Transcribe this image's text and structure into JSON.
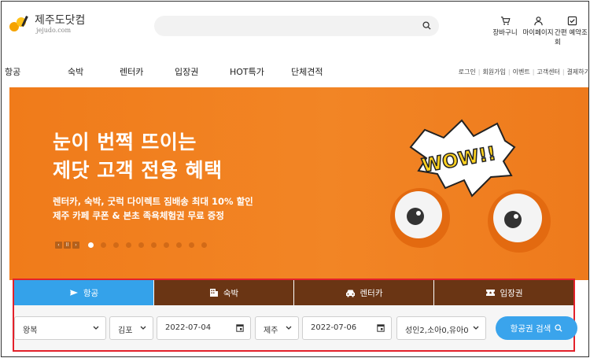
{
  "logo": {
    "name": "제주도닷컴",
    "sub": "jejudo.com"
  },
  "search": {
    "placeholder": ""
  },
  "utility": {
    "cart": "장바구니",
    "mypage": "마이페이지",
    "quick": "간편 예약조회"
  },
  "nav": {
    "items": [
      "항공",
      "숙박",
      "렌터카",
      "입장권",
      "HOT특가",
      "단체견적"
    ],
    "sub": [
      "로그인",
      "회원가입",
      "이벤트",
      "고객센터",
      "결제하기"
    ]
  },
  "banner": {
    "title_line1": "눈이 번쩍 뜨이는",
    "title_line2": "제닷 고객 전용 혜택",
    "desc_line1": "렌터카, 숙박, 굿럭 다이렉트 짐배송 최대 10% 할인",
    "desc_line2": "제주 카페 쿠폰 & 본초 족욕체험권 무료 증정",
    "art_text": "WOW!!",
    "slide_count": 10,
    "active_slide": 1
  },
  "tabs": [
    {
      "label": "항공",
      "icon": "plane-icon"
    },
    {
      "label": "숙박",
      "icon": "building-icon"
    },
    {
      "label": "렌터카",
      "icon": "car-icon"
    },
    {
      "label": "입장권",
      "icon": "ticket-icon"
    }
  ],
  "form": {
    "trip_type": "왕복",
    "departure": "김포",
    "depart_date": "2022-07-04",
    "arrival": "제주",
    "return_date": "2022-07-06",
    "passengers": "성인2,소아0,유아0",
    "search_button": "항공권 검색"
  },
  "colors": {
    "banner": "#f28525",
    "tab_active": "#34a2ea",
    "tab": "#6a3514",
    "highlight": "#e3212a"
  }
}
